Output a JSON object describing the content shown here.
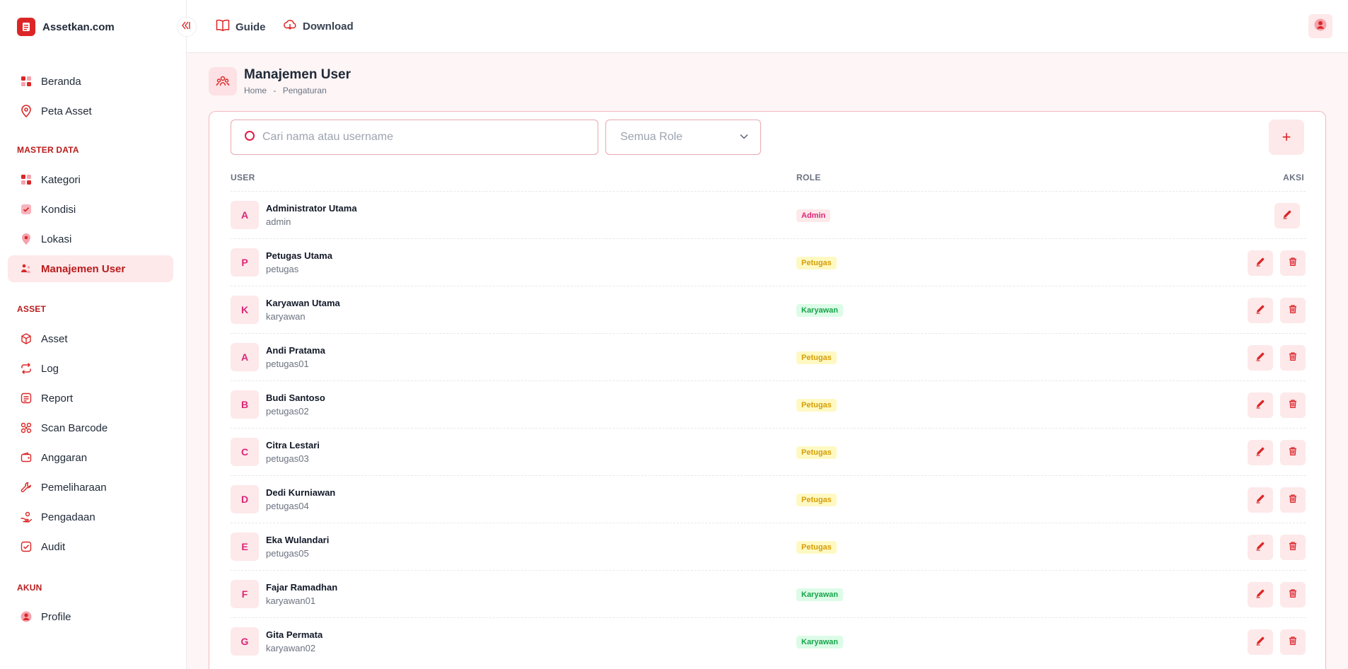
{
  "app": {
    "name": "Assetkan.com"
  },
  "topbar": {
    "guide": "Guide",
    "download": "Download"
  },
  "sidebar": {
    "items": [
      {
        "label": "Beranda"
      },
      {
        "label": "Peta Asset"
      }
    ],
    "sections": [
      {
        "title": "MASTER DATA",
        "items": [
          {
            "label": "Kategori"
          },
          {
            "label": "Kondisi"
          },
          {
            "label": "Lokasi"
          },
          {
            "label": "Manajemen User"
          }
        ]
      },
      {
        "title": "ASSET",
        "items": [
          {
            "label": "Asset"
          },
          {
            "label": "Log"
          },
          {
            "label": "Report"
          },
          {
            "label": "Scan Barcode"
          },
          {
            "label": "Anggaran"
          },
          {
            "label": "Pemeliharaan"
          },
          {
            "label": "Pengadaan"
          },
          {
            "label": "Audit"
          }
        ]
      },
      {
        "title": "AKUN",
        "items": [
          {
            "label": "Profile"
          }
        ]
      }
    ]
  },
  "page": {
    "title": "Manajemen User",
    "breadcrumb": {
      "home": "Home",
      "sep": "-",
      "current": "Pengaturan"
    }
  },
  "filters": {
    "search_placeholder": "Cari nama atau username",
    "role_selected": "Semua Role",
    "add_label": "+"
  },
  "table": {
    "headers": {
      "user": "USER",
      "role": "ROLE",
      "aksi": "AKSI"
    },
    "rows": [
      {
        "initial": "A",
        "name": "Administrator Utama",
        "username": "admin",
        "role": "Admin"
      },
      {
        "initial": "P",
        "name": "Petugas Utama",
        "username": "petugas",
        "role": "Petugas"
      },
      {
        "initial": "K",
        "name": "Karyawan Utama",
        "username": "karyawan",
        "role": "Karyawan"
      },
      {
        "initial": "A",
        "name": "Andi Pratama",
        "username": "petugas01",
        "role": "Petugas"
      },
      {
        "initial": "B",
        "name": "Budi Santoso",
        "username": "petugas02",
        "role": "Petugas"
      },
      {
        "initial": "C",
        "name": "Citra Lestari",
        "username": "petugas03",
        "role": "Petugas"
      },
      {
        "initial": "D",
        "name": "Dedi Kurniawan",
        "username": "petugas04",
        "role": "Petugas"
      },
      {
        "initial": "E",
        "name": "Eka Wulandari",
        "username": "petugas05",
        "role": "Petugas"
      },
      {
        "initial": "F",
        "name": "Fajar Ramadhan",
        "username": "karyawan01",
        "role": "Karyawan"
      },
      {
        "initial": "G",
        "name": "Gita Permata",
        "username": "karyawan02",
        "role": "Karyawan"
      }
    ]
  },
  "icons": {
    "brand": "clipboard-icon",
    "collapse": "sidebar-collapse-icon",
    "guide": "book-icon",
    "download": "cloud-download-icon",
    "user": "user-icon",
    "edit": "pencil-icon",
    "delete": "trash-icon",
    "search": "search-icon",
    "dropdown": "chevron-down-icon"
  },
  "colors": {
    "accent": "#dc2626",
    "accent_soft": "#fde8ea",
    "background": "#fdf5f6"
  }
}
